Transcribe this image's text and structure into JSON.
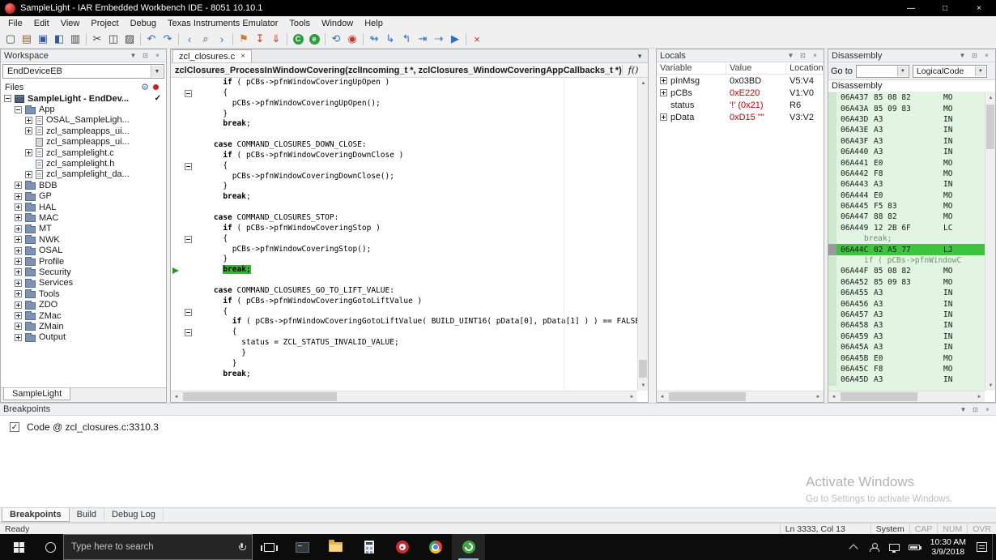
{
  "colors": {
    "exec_highlight": "#33b733",
    "error_value": "#cc0000",
    "disasm_bg": "#e2f5e2",
    "disasm_hl": "#3fc43f",
    "accent_blue": "#76b9ed"
  },
  "icons": {
    "dropdown": "▼",
    "pin": "⊡",
    "close_x": "×",
    "minimize": "—",
    "maximize": "□",
    "check": "✓",
    "gear": "⚙"
  },
  "titlebar": {
    "title": "SampleLight - IAR Embedded Workbench IDE - 8051 10.10.1"
  },
  "menubar": {
    "items": [
      "File",
      "Edit",
      "View",
      "Project",
      "Debug",
      "Texas Instruments Emulator",
      "Tools",
      "Window",
      "Help"
    ]
  },
  "toolbar": {
    "items": [
      {
        "name": "new-document-icon",
        "glyph": "▢"
      },
      {
        "name": "open-file-icon",
        "glyph": "▤",
        "color": "#8a6b28"
      },
      {
        "name": "save-icon",
        "glyph": "▣",
        "color": "#33589e"
      },
      {
        "name": "save-all-icon",
        "glyph": "◧",
        "color": "#33589e"
      },
      {
        "name": "print-icon",
        "glyph": "▥"
      },
      {
        "sep": true
      },
      {
        "name": "cut-icon",
        "glyph": "✂"
      },
      {
        "name": "copy-icon",
        "glyph": "◫"
      },
      {
        "name": "paste-icon",
        "glyph": "▨"
      },
      {
        "sep": true
      },
      {
        "name": "undo-icon",
        "glyph": "↶",
        "color": "#2a6fd0"
      },
      {
        "name": "redo-icon",
        "glyph": "↷",
        "color": "#2a6fd0"
      },
      {
        "sep": true
      },
      {
        "name": "navigate-back-icon",
        "glyph": "‹",
        "color": "#2a6fd0"
      },
      {
        "name": "find-icon",
        "glyph": "⌕"
      },
      {
        "name": "navigate-forward-icon",
        "glyph": "›",
        "color": "#2a6fd0"
      },
      {
        "sep": true
      },
      {
        "name": "toggle-bookmark-icon",
        "glyph": "⚑",
        "color": "#d07a2a"
      },
      {
        "name": "download-and-debug-icon",
        "glyph": "↧",
        "color": "#c0392b"
      },
      {
        "name": "debug-without-downloading-icon",
        "glyph": "⇓",
        "color": "#c0392b"
      },
      {
        "sep": true
      },
      {
        "name": "cstat-analysis-icon",
        "letter": "C",
        "disc": "#2e9e40"
      },
      {
        "name": "cspy-icon",
        "letter": "e",
        "disc": "#2e9e40"
      },
      {
        "sep": true
      },
      {
        "name": "reset-icon",
        "glyph": "⟲",
        "color": "#2a6fd0"
      },
      {
        "name": "break-icon",
        "glyph": "◉",
        "color": "#c0392b"
      },
      {
        "sep": true
      },
      {
        "name": "step-over-icon",
        "glyph": "↬",
        "color": "#2a6fd0"
      },
      {
        "name": "step-into-icon",
        "glyph": "↳",
        "color": "#2a6fd0"
      },
      {
        "name": "step-out-icon",
        "glyph": "↰",
        "color": "#2a6fd0"
      },
      {
        "name": "next-statement-icon",
        "glyph": "⇥",
        "color": "#2a6fd0"
      },
      {
        "name": "run-to-cursor-icon",
        "glyph": "⇢",
        "color": "#2a6fd0"
      },
      {
        "name": "go-icon",
        "glyph": "▶",
        "color": "#2a6fd0"
      },
      {
        "sep": true
      },
      {
        "name": "stop-debugging-icon",
        "glyph": "×",
        "color": "#c0392b"
      }
    ]
  },
  "workspace": {
    "title": "Workspace",
    "target_select": "EndDeviceEB",
    "files_label": "Files",
    "tab": "SampleLight",
    "tree": [
      {
        "label": "SampleLight - EndDev...",
        "level": 0,
        "expand": "minus",
        "icon": "project",
        "bold": true,
        "check": true
      },
      {
        "label": "App",
        "level": 1,
        "expand": "minus",
        "icon": "folder"
      },
      {
        "label": "OSAL_SampleLigh...",
        "level": 2,
        "expand": "plus",
        "icon": "file"
      },
      {
        "label": "zcl_sampleapps_ui...",
        "level": 2,
        "expand": "plus",
        "icon": "file"
      },
      {
        "label": "zcl_sampleapps_ui...",
        "level": 2,
        "expand": null,
        "icon": "file-gray"
      },
      {
        "label": "zcl_samplelight.c",
        "level": 2,
        "expand": "plus",
        "icon": "file"
      },
      {
        "label": "zcl_samplelight.h",
        "level": 2,
        "expand": null,
        "icon": "file"
      },
      {
        "label": "zcl_samplelight_da...",
        "level": 2,
        "expand": "plus",
        "icon": "file"
      },
      {
        "label": "BDB",
        "level": 1,
        "expand": "plus",
        "icon": "folder"
      },
      {
        "label": "GP",
        "level": 1,
        "expand": "plus",
        "icon": "folder"
      },
      {
        "label": "HAL",
        "level": 1,
        "expand": "plus",
        "icon": "folder"
      },
      {
        "label": "MAC",
        "level": 1,
        "expand": "plus",
        "icon": "folder"
      },
      {
        "label": "MT",
        "level": 1,
        "expand": "plus",
        "icon": "folder"
      },
      {
        "label": "NWK",
        "level": 1,
        "expand": "plus",
        "icon": "folder"
      },
      {
        "label": "OSAL",
        "level": 1,
        "expand": "plus",
        "icon": "folder"
      },
      {
        "label": "Profile",
        "level": 1,
        "expand": "plus",
        "icon": "folder"
      },
      {
        "label": "Security",
        "level": 1,
        "expand": "plus",
        "icon": "folder"
      },
      {
        "label": "Services",
        "level": 1,
        "expand": "plus",
        "icon": "folder"
      },
      {
        "label": "Tools",
        "level": 1,
        "expand": "plus",
        "icon": "folder"
      },
      {
        "label": "ZDO",
        "level": 1,
        "expand": "plus",
        "icon": "folder"
      },
      {
        "label": "ZMac",
        "level": 1,
        "expand": "plus",
        "icon": "folder"
      },
      {
        "label": "ZMain",
        "level": 1,
        "expand": "plus",
        "icon": "folder"
      },
      {
        "label": "Output",
        "level": 1,
        "expand": "plus",
        "icon": "folder"
      }
    ]
  },
  "editor": {
    "tab": "zcl_closures.c",
    "signature": "zclClosures_ProcessInWindowCovering(zclIncoming_t *, zclClosures_WindowCoveringAppCallbacks_t *)",
    "fn_button": "f()",
    "lines": [
      {
        "t": "      if ( pCBs->pfnWindowCoveringUpOpen )"
      },
      {
        "t": "      {",
        "fold": true
      },
      {
        "t": "        pCBs->pfnWindowCoveringUpOpen();"
      },
      {
        "t": "      }"
      },
      {
        "t": "      break;"
      },
      {
        "t": ""
      },
      {
        "t": "    case COMMAND_CLOSURES_DOWN_CLOSE:"
      },
      {
        "t": "      if ( pCBs->pfnWindowCoveringDownClose )"
      },
      {
        "t": "      {",
        "fold": true
      },
      {
        "t": "        pCBs->pfnWindowCoveringDownClose();"
      },
      {
        "t": "      }"
      },
      {
        "t": "      break;"
      },
      {
        "t": ""
      },
      {
        "t": "    case COMMAND_CLOSURES_STOP:"
      },
      {
        "t": "      if ( pCBs->pfnWindowCoveringStop )"
      },
      {
        "t": "      {",
        "fold": true
      },
      {
        "t": "        pCBs->pfnWindowCoveringStop();"
      },
      {
        "t": "      }"
      },
      {
        "t": "      break;",
        "hl": true,
        "cur": true
      },
      {
        "t": ""
      },
      {
        "t": "    case COMMAND_CLOSURES_GO_TO_LIFT_VALUE:"
      },
      {
        "t": "      if ( pCBs->pfnWindowCoveringGotoLiftValue )"
      },
      {
        "t": "      {",
        "fold": true
      },
      {
        "t": "        if ( pCBs->pfnWindowCoveringGotoLiftValue( BUILD_UINT16( pData[0], pData[1] ) ) == FALSE"
      },
      {
        "t": "        {",
        "fold": true
      },
      {
        "t": "          status = ZCL_STATUS_INVALID_VALUE;"
      },
      {
        "t": "          }"
      },
      {
        "t": "        }"
      },
      {
        "t": "      break;"
      },
      {
        "t": ""
      }
    ]
  },
  "locals": {
    "title": "Locals",
    "columns": [
      "Variable",
      "Value",
      "Location"
    ],
    "rows": [
      {
        "expand": true,
        "name": "pInMsg",
        "value": "0x03BD",
        "red": false,
        "location": "V5:V4"
      },
      {
        "expand": true,
        "name": "pCBs",
        "value": "0xE220",
        "red": true,
        "location": "V1:V0"
      },
      {
        "expand": false,
        "name": "status",
        "value": "'!' (0x21)",
        "red": true,
        "location": "R6"
      },
      {
        "expand": true,
        "name": "pData",
        "value": "0xD15 \"\"",
        "red": true,
        "location": "V3:V2"
      }
    ]
  },
  "disassembly": {
    "title": "Disassembly",
    "goto_label": "Go to",
    "goto_value": "",
    "mode_value": "LogicalCode",
    "section_label": "Disassembly",
    "rows": [
      {
        "addr": "06A437",
        "bytes": "85 08 82",
        "mn": "MO"
      },
      {
        "addr": "06A43A",
        "bytes": "85 09 83",
        "mn": "MO"
      },
      {
        "addr": "06A43D",
        "bytes": "A3",
        "mn": "IN"
      },
      {
        "addr": "06A43E",
        "bytes": "A3",
        "mn": "IN"
      },
      {
        "addr": "06A43F",
        "bytes": "A3",
        "mn": "IN"
      },
      {
        "addr": "06A440",
        "bytes": "A3",
        "mn": "IN"
      },
      {
        "addr": "06A441",
        "bytes": "E0",
        "mn": "MO"
      },
      {
        "addr": "06A442",
        "bytes": "F8",
        "mn": "MO"
      },
      {
        "addr": "06A443",
        "bytes": "A3",
        "mn": "IN"
      },
      {
        "addr": "06A444",
        "bytes": "E0",
        "mn": "MO"
      },
      {
        "addr": "06A445",
        "bytes": "F5 83",
        "mn": "MO"
      },
      {
        "addr": "06A447",
        "bytes": "88 82",
        "mn": "MO"
      },
      {
        "addr": "06A449",
        "bytes": "12 2B 6F",
        "mn": "LC"
      },
      {
        "src": "break;"
      },
      {
        "addr": "06A44C",
        "bytes": "02 A5 77",
        "mn": "LJ",
        "hl": true
      },
      {
        "src": "if ( pCBs->pfnWindowC"
      },
      {
        "addr": "06A44F",
        "bytes": "85 08 82",
        "mn": "MO"
      },
      {
        "addr": "06A452",
        "bytes": "85 09 83",
        "mn": "MO"
      },
      {
        "addr": "06A455",
        "bytes": "A3",
        "mn": "IN"
      },
      {
        "addr": "06A456",
        "bytes": "A3",
        "mn": "IN"
      },
      {
        "addr": "06A457",
        "bytes": "A3",
        "mn": "IN"
      },
      {
        "addr": "06A458",
        "bytes": "A3",
        "mn": "IN"
      },
      {
        "addr": "06A459",
        "bytes": "A3",
        "mn": "IN"
      },
      {
        "addr": "06A45A",
        "bytes": "A3",
        "mn": "IN"
      },
      {
        "addr": "06A45B",
        "bytes": "E0",
        "mn": "MO"
      },
      {
        "addr": "06A45C",
        "bytes": "F8",
        "mn": "MO"
      },
      {
        "addr": "06A45D",
        "bytes": "A3",
        "mn": "IN"
      }
    ]
  },
  "breakpoints": {
    "title": "Breakpoints",
    "items": [
      {
        "checked": true,
        "label": "Code @ zcl_closures.c:3310.3"
      }
    ],
    "tabs": [
      "Breakpoints",
      "Build",
      "Debug Log"
    ],
    "active_tab": "Breakpoints"
  },
  "watermark": {
    "line1": "Activate Windows",
    "line2": "Go to Settings to activate Windows."
  },
  "statusbar": {
    "ready": "Ready",
    "cells": [
      {
        "t": "Ln 3333, Col 13"
      },
      {
        "t": "System"
      },
      {
        "t": "CAP",
        "dim": true
      },
      {
        "t": "NUM",
        "dim": true
      },
      {
        "t": "OVR",
        "dim": true
      }
    ]
  },
  "taskbar": {
    "search_placeholder": "Type here to search",
    "clock_time": "10:30 AM",
    "clock_date": "3/9/2018",
    "apps": [
      {
        "name": "task-view-icon"
      },
      {
        "name": "terminal-app-icon"
      },
      {
        "name": "file-explorer-icon"
      },
      {
        "name": "calculator-app-icon"
      },
      {
        "name": "red-app-icon"
      },
      {
        "name": "chrome-icon"
      },
      {
        "name": "iar-debugger-icon",
        "active": true
      }
    ],
    "tray": [
      "chevron-up-icon",
      "people-icon",
      "display-icon",
      "battery-icon"
    ]
  }
}
